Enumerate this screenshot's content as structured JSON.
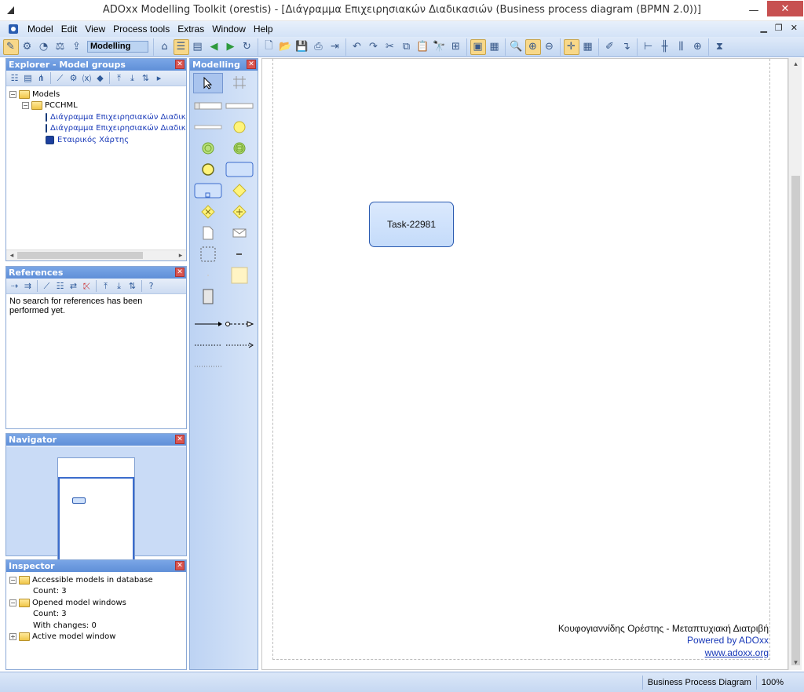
{
  "window": {
    "title": "ADOxx Modelling Toolkit (orestis) - [Διάγραμμα Επιχειρησιακών Διαδικασιών (Business process diagram (BPMN 2.0))]",
    "minimize": "—",
    "close": "✕"
  },
  "menu": [
    {
      "label": "Model"
    },
    {
      "label": "Edit"
    },
    {
      "label": "View"
    },
    {
      "label": "Process tools"
    },
    {
      "label": "Extras"
    },
    {
      "label": "Window"
    },
    {
      "label": "Help"
    }
  ],
  "toolbar": {
    "mode": "Modelling"
  },
  "explorer": {
    "title": "Explorer - Model groups",
    "tree": [
      {
        "label": "Models",
        "level": 0
      },
      {
        "label": "PCCHML",
        "level": 1
      },
      {
        "label": "Διάγραμμα Επιχειρησιακών Διαδικασιών",
        "level": 2
      },
      {
        "label": "Διάγραμμα Επιχειρησιακών Διαδικασιών",
        "level": 2
      },
      {
        "label": "Εταιρικός Χάρτης",
        "level": 2
      }
    ]
  },
  "references": {
    "title": "References",
    "message": "No search for references has been performed yet."
  },
  "navigator": {
    "title": "Navigator"
  },
  "inspector": {
    "title": "Inspector",
    "items": [
      {
        "label": "Accessible models in database"
      },
      {
        "label": "Count: 3"
      },
      {
        "label": "Opened model windows"
      },
      {
        "label": "Count: 3"
      },
      {
        "label": "With changes: 0"
      },
      {
        "label": "Active model window"
      }
    ]
  },
  "palette": {
    "title": "Modelling"
  },
  "canvas": {
    "task_label": "Task-22981",
    "footer_line1": "Κουφογιαννίδης Ορέστης - Μεταπτυχιακή Διατριβή",
    "footer_line2": "Powered by ADOxx",
    "footer_line3": "www.adoxx.org"
  },
  "statusbar": {
    "model_type": "Business Process Diagram",
    "zoom": "100%"
  },
  "colors": {
    "accent": "#5f8fd8",
    "task_fill": "#c4dbfa",
    "task_border": "#2a5ab0",
    "link": "#1a3ab8"
  }
}
